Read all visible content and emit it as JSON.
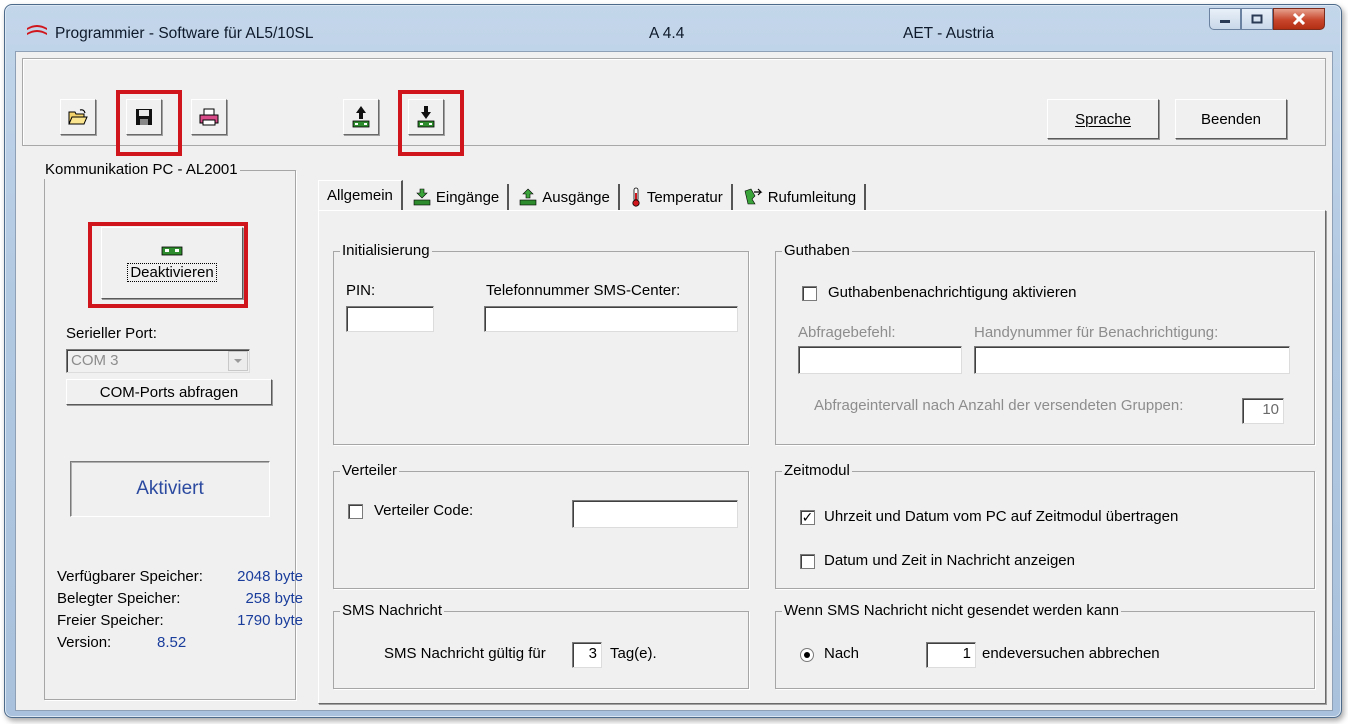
{
  "window": {
    "title": "Programmier - Software für AL5/10SL",
    "version": "A 4.4",
    "vendor": "AET - Austria"
  },
  "toolbar": {
    "open_icon": "open-folder-icon",
    "save_icon": "floppy-disk-icon",
    "print_icon": "printer-icon",
    "upload_icon": "upload-to-module-icon",
    "download_icon": "download-from-module-icon",
    "language_label": "Sprache",
    "exit_label": "Beenden"
  },
  "communication": {
    "title": "Kommunikation PC - AL2001",
    "deactivate_label": "Deaktivieren",
    "serial_port_label": "Serieller Port:",
    "serial_port_value": "COM 3",
    "query_ports_label": "COM-Ports abfragen",
    "status": "Aktiviert",
    "memory": [
      {
        "label": "Verfügbarer Speicher:",
        "value": "2048 byte"
      },
      {
        "label": "Belegter Speicher:",
        "value": "258 byte"
      },
      {
        "label": "Freier Speicher:",
        "value": "1790 byte"
      },
      {
        "label": "Version:",
        "value": "8.52"
      }
    ]
  },
  "tabs": [
    {
      "label": "Allgemein",
      "icon": "",
      "active": true
    },
    {
      "label": "Eingänge",
      "icon": "input-module-icon",
      "active": false
    },
    {
      "label": "Ausgänge",
      "icon": "output-module-icon",
      "active": false
    },
    {
      "label": "Temperatur",
      "icon": "thermometer-icon",
      "active": false
    },
    {
      "label": "Rufumleitung",
      "icon": "call-forward-icon",
      "active": false
    }
  ],
  "initialisierung": {
    "title": "Initialisierung",
    "pin_label": "PIN:",
    "pin_value": "",
    "sms_center_label": "Telefonnummer SMS-Center:",
    "sms_center_value": ""
  },
  "guthaben": {
    "title": "Guthaben",
    "notify_label": "Guthabenbenachrichtigung aktivieren",
    "notify_checked": false,
    "query_cmd_label": "Abfragebefehl:",
    "query_cmd_value": "",
    "phone_label": "Handynummer für Benachrichtigung:",
    "phone_value": "",
    "interval_label": "Abfrageintervall nach Anzahl der versendeten Gruppen:",
    "interval_value": "10"
  },
  "verteiler": {
    "title": "Verteiler",
    "code_label": "Verteiler Code:",
    "code_checked": false,
    "code_value": ""
  },
  "zeitmodul": {
    "title": "Zeitmodul",
    "transfer_label": "Uhrzeit und Datum vom PC auf Zeitmodul übertragen",
    "transfer_checked": true,
    "show_label": "Datum und Zeit in Nachricht anzeigen",
    "show_checked": false
  },
  "sms": {
    "title": "SMS Nachricht",
    "valid_label": "SMS Nachricht gültig für",
    "valid_value": "3",
    "valid_unit": "Tag(e)."
  },
  "fail": {
    "title": "Wenn SMS Nachricht nicht gesendet werden kann",
    "after_label": "Nach",
    "after_value": "1",
    "suffix": "endeversuchen abbrechen"
  },
  "colors": {
    "highlight": "#d0161c",
    "status_text": "#2b4aa0",
    "memory_value": "#1a3d9c"
  }
}
